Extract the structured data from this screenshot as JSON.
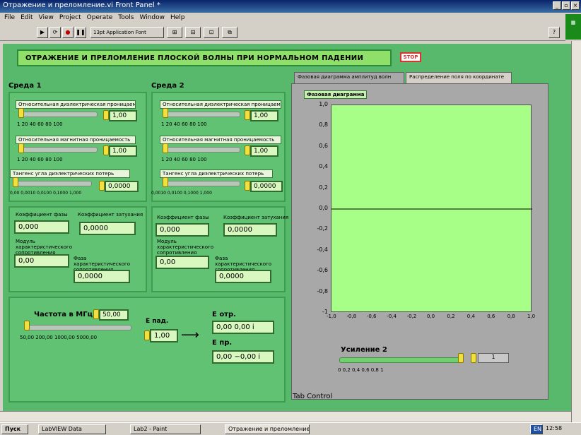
{
  "window": {
    "title": "Отражение и преломление.vi Front Panel *",
    "controls": [
      "_",
      "▫",
      "×"
    ]
  },
  "menu": [
    "File",
    "Edit",
    "View",
    "Project",
    "Operate",
    "Tools",
    "Window",
    "Help"
  ],
  "toolbar": {
    "font_label": "13pt Application Font",
    "help_label": "?"
  },
  "panel": {
    "title": "ОТРАЖЕНИЕ И ПРЕЛОМЛЕНИЕ ПЛОСКОЙ ВОЛНЫ ПРИ НОРМАЛЬНОМ ПАДЕНИИ",
    "stop_label": "STOP"
  },
  "medium1": {
    "heading": "Среда 1",
    "eps_label": "Относительная диэлектрическая проницаемость",
    "eps_value": "1,00",
    "eps_ticks": "1   20   40   60   80  100",
    "eps_level": 0.0,
    "mu_label": "Относительная магнитная проницаемость",
    "mu_value": "1,00",
    "mu_ticks": "1   20   40   60   80  100",
    "mu_level": 0.0,
    "tan_label": "Тангенс угла диэлектрических потерь",
    "tan_value": "0,0000",
    "tan_ticks": "0,00  0,0010  0,0100  0,1000  1,000",
    "tan_level": 0.0
  },
  "medium2": {
    "heading": "Среда 2",
    "eps_label": "Относительная диэлектрическая проницаемость",
    "eps_value": "1,00",
    "eps_ticks": "1   20   40   60   80  100",
    "eps_level": 0.0,
    "mu_label": "Относительная магнитная проницаемость",
    "mu_value": "1,00",
    "mu_ticks": "1   20   40   60   80  100",
    "mu_level": 0.0,
    "tan_label": "Тангенс угла диэлектрических потерь",
    "tan_value": "0,0000",
    "tan_ticks": "0,0010  0,0100  0,1000  1,000",
    "tan_level": 0.0
  },
  "results1": {
    "phase_label": "Коэффициент фазы",
    "phase_value": "0,000",
    "atten_label": "Коэффициент затухания",
    "atten_value": "0,0000",
    "impedance_label": "Модуль характеристического сопротивления",
    "impedance_value": "0,00",
    "impedance_phase_label": "Фаза характеристического сопротивления",
    "impedance_phase_value": "0,0000"
  },
  "results2": {
    "phase_label": "Коэффициент фазы",
    "phase_value": "0,000",
    "atten_label": "Коэффициент затухания",
    "atten_value": "0,0000",
    "impedance_label": "Модуль характеристического сопротивления",
    "impedance_value": "0,00",
    "impedance_phase_label": "Фаза характеристического сопротивления",
    "impedance_phase_value": "0,0000"
  },
  "frequency": {
    "label": "Частота в МГц",
    "value": "50,00",
    "ticks": "50,00   200,00   1000,00   5000,00",
    "level": 0.0
  },
  "fields": {
    "incident_label": "Е пад.",
    "incident_value": "1,00",
    "arrow": "⟶",
    "reflected_label": "Е отр.",
    "reflected_value": "0,00  0,00 i",
    "transmitted_label": "Е пр.",
    "transmitted_value": "0,00 −0,00 i"
  },
  "tabs": {
    "tab1": "Фазовая диаграмма амплитуд волн",
    "tab2": "Распределение поля по координате",
    "plot_caption": "Фазовая диаграмма",
    "control_label": "Tab Control"
  },
  "chart_data": {
    "type": "line",
    "title": "Фазовая диаграмма",
    "xlim": [
      -1.0,
      1.0
    ],
    "ylim": [
      -1.0,
      1.0
    ],
    "x_ticks": [
      "-1,0",
      "-0,8",
      "-0,6",
      "-0,4",
      "-0,2",
      "0,0",
      "0,2",
      "0,4",
      "0,6",
      "0,8",
      "1,0"
    ],
    "y_ticks": [
      "1,0",
      "0,8",
      "0,6",
      "0,4",
      "0,2",
      "0,0",
      "-0,2",
      "-0,4",
      "-0,6",
      "-0,8",
      "-1"
    ],
    "series": [
      {
        "values": [
          [
            -1.0,
            0.0
          ],
          [
            1.0,
            0.0
          ]
        ]
      }
    ],
    "grid": false
  },
  "gain": {
    "label": "Усиление 2",
    "value": "1",
    "ticks": "0   0,2   0,4   0,6   0,8   1",
    "level": 1.0
  },
  "taskbar": {
    "start": "Пуск",
    "items": [
      "LabVIEW Data",
      "Lab2 - Paint",
      "Отражение и преломление..."
    ],
    "lang": "EN",
    "clock": "12:58"
  },
  "colors": {
    "panel_bg": "#58b86c",
    "plot_bg": "#a8ff88",
    "stop_red": "#e03030"
  }
}
